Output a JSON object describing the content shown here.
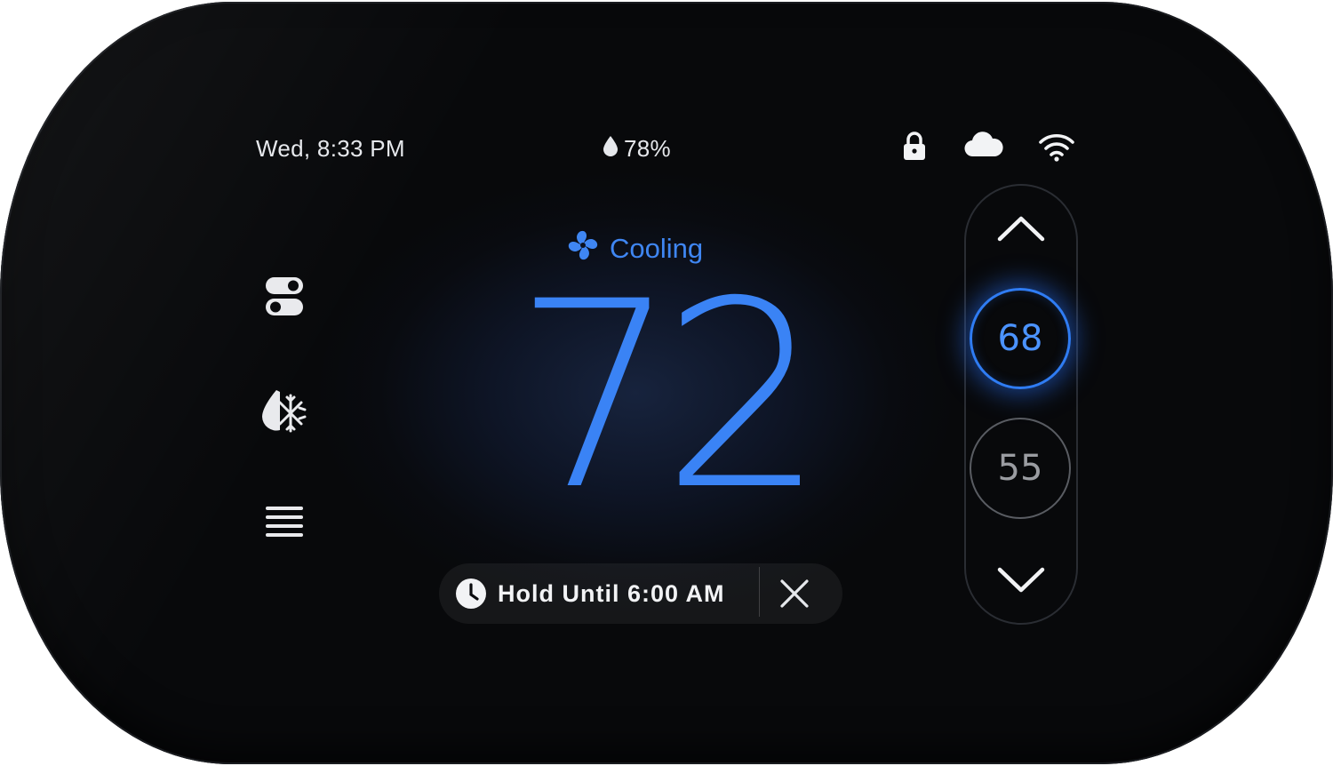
{
  "status_bar": {
    "datetime": "Wed, 8:33 PM",
    "humidity": "78%",
    "icons": [
      "lock-icon",
      "cloud-icon",
      "wifi-icon"
    ]
  },
  "sidebar": {
    "items": [
      "toggles-icon",
      "cool-heat-mode-icon",
      "menu-icon"
    ]
  },
  "main": {
    "mode_label": "Cooling",
    "current_temperature": "72",
    "hold_label": "Hold Until 6:00 AM"
  },
  "setpoints": {
    "cool": "68",
    "heat": "55"
  },
  "colors": {
    "accent_blue": "#3a83f5",
    "text_white": "#e6e8ec",
    "heat_gray": "#9a9ca1",
    "screen_black": "#08090b"
  }
}
